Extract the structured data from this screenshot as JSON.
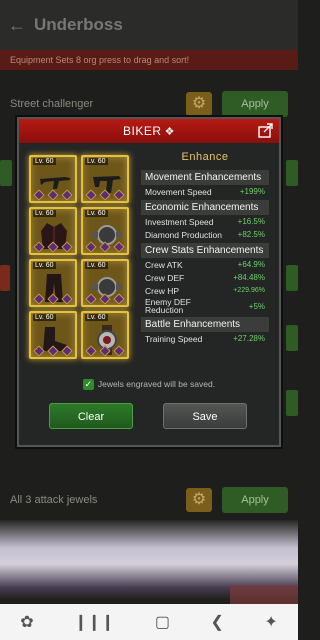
{
  "background": {
    "title": "Underboss",
    "banner": "Equipment Sets 8 org press to drag and sort!",
    "rows": [
      {
        "label": "Street challenger",
        "apply": "Apply"
      },
      {
        "label": "All 3 attack jewels",
        "apply": "Apply"
      }
    ]
  },
  "dialog": {
    "title": "BIKER",
    "items": [
      {
        "level": "Lv. 60",
        "icon": "rifle-icon"
      },
      {
        "level": "Lv. 60",
        "icon": "smg-icon"
      },
      {
        "level": "Lv. 60",
        "icon": "jacket-icon"
      },
      {
        "level": "Lv. 60",
        "icon": "watch-icon"
      },
      {
        "level": "Lv. 60",
        "icon": "pants-icon"
      },
      {
        "level": "Lv. 60",
        "icon": "watch-icon"
      },
      {
        "level": "Lv. 60",
        "icon": "boots-icon"
      },
      {
        "level": "Lv. 60",
        "icon": "wristwatch-icon"
      }
    ],
    "enhance_title": "Enhance",
    "sections": [
      {
        "head": "Movement Enhancements",
        "stats": [
          {
            "name": "Movement Speed",
            "value": "+199%"
          }
        ]
      },
      {
        "head": "Economic Enhancements",
        "stats": [
          {
            "name": "Investment Speed",
            "value": "+16.5%"
          },
          {
            "name": "Diamond Production",
            "value": "+82.5%"
          }
        ]
      },
      {
        "head": "Crew Stats Enhancements",
        "stats": [
          {
            "name": "Crew ATK",
            "value": "+64.9%"
          },
          {
            "name": "Crew DEF",
            "value": "+84.48%"
          },
          {
            "name": "Crew HP",
            "value": "+229.96%"
          },
          {
            "name": "Enemy DEF Reduction",
            "value": "+5%"
          }
        ]
      },
      {
        "head": "Battle Enhancements",
        "stats": [
          {
            "name": "Training Speed",
            "value": "+27.28%"
          }
        ]
      }
    ],
    "save_note": "Jewels engraved will be saved.",
    "clear_label": "Clear",
    "save_label": "Save"
  },
  "colors": {
    "header_red": "#b61a14",
    "gold_border": "#e5c23a",
    "stat_green": "#6dd16b",
    "clear_green": "#2e7a29"
  }
}
